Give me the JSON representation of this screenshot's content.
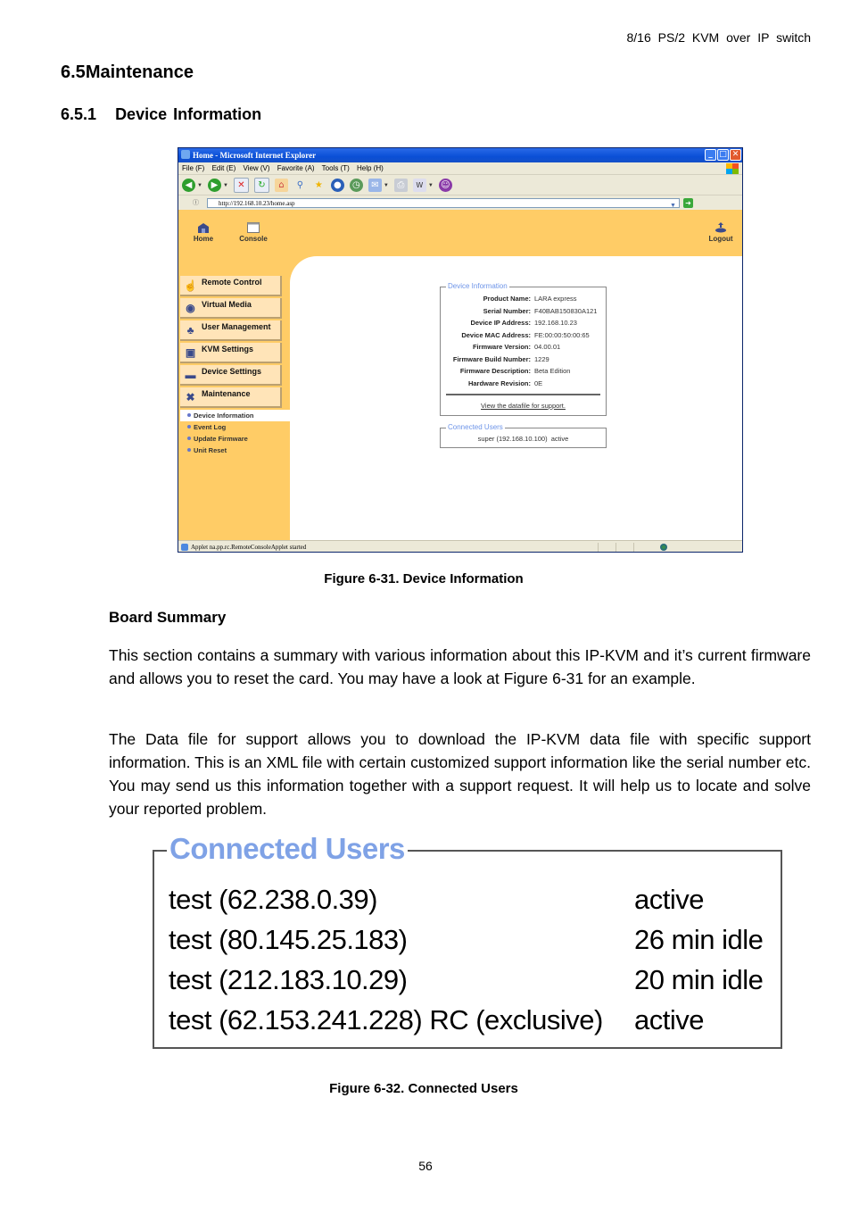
{
  "running_header": "8/16 PS/2 KVM over IP switch",
  "section": {
    "number": "6.5",
    "title": "Maintenance"
  },
  "subsection": {
    "number": "6.5.1",
    "title": "Device Information"
  },
  "browser": {
    "title": "Home - Microsoft Internet Explorer",
    "window_buttons": {
      "minimize": "_",
      "maximize": "□",
      "close": "✕"
    },
    "menu": [
      "File (F)",
      "Edit (E)",
      "View (V)",
      "Favorite (A)",
      "Tools (T)",
      "Help (H)"
    ],
    "address_label": "Ⓘ",
    "address": "http://192.168.10.23/home.asp",
    "top_nav": [
      {
        "label": "Home",
        "icon": "home-icon"
      },
      {
        "label": "Console",
        "icon": "console-window-icon"
      },
      {
        "label": "Logout",
        "icon": "logout-icon"
      }
    ],
    "sidebar": [
      {
        "label": "Remote Control",
        "icon": "remote-control-hand-icon"
      },
      {
        "label": "Virtual Media",
        "icon": "virtual-media-disc-icon"
      },
      {
        "label": "User Management",
        "icon": "users-icon"
      },
      {
        "label": "KVM Settings",
        "icon": "computer-icon"
      },
      {
        "label": "Device Settings",
        "icon": "device-icon"
      },
      {
        "label": "Maintenance",
        "icon": "tools-icon"
      }
    ],
    "submenu": [
      {
        "label": "Device Information",
        "active": true
      },
      {
        "label": "Event Log",
        "active": false
      },
      {
        "label": "Update Firmware",
        "active": false
      },
      {
        "label": "Unit Reset",
        "active": false
      }
    ],
    "device_info": {
      "legend": "Device Information",
      "rows": [
        {
          "label": "Product Name:",
          "value": "LARA express"
        },
        {
          "label": "Serial Number:",
          "value": "F40BAB150830A121"
        },
        {
          "label": "Device IP Address:",
          "value": "192.168.10.23"
        },
        {
          "label": "Device MAC Address:",
          "value": "FE:00:00:50:00:65"
        },
        {
          "label": "Firmware Version:",
          "value": "04.00.01"
        },
        {
          "label": "Firmware Build Number:",
          "value": "1229"
        },
        {
          "label": "Firmware Description:",
          "value": "Beta Edition"
        },
        {
          "label": "Hardware Revision:",
          "value": "0E"
        }
      ],
      "datafile_link": "View the datafile for support."
    },
    "connected_users_small": {
      "legend": "Connected Users",
      "entry": "super (192.168.10.100)  active"
    },
    "status_text": "Applet na.pp.rc.RemoteConsoleApplet started"
  },
  "figure1_caption": "Figure 6-31. Device Information",
  "board_summary": {
    "heading": "Board Summary",
    "paragraph1": "This section contains a summary with various information about this IP-KVM and it’s current firmware and allows you to reset the card. You may have a look at Figure 6-31 for an example.",
    "paragraph2": "The Data file for support allows you to download the IP-KVM data file with specific support information. This is an XML file with certain customized support information like the serial number etc. You may send us this information together with a support request. It will help us to locate and solve your reported problem."
  },
  "connected_users": {
    "legend": "Connected Users",
    "rows": [
      {
        "user": "test (62.238.0.39)",
        "status": "active"
      },
      {
        "user": "test (80.145.25.183)",
        "status": "26 min idle"
      },
      {
        "user": "test (212.183.10.29)",
        "status": "20 min idle"
      },
      {
        "user": "test (62.153.241.228) RC (exclusive)",
        "status": "active"
      }
    ]
  },
  "figure2_caption": "Figure 6-32. Connected Users",
  "page_number": "56",
  "colors": {
    "page_yellow": "#ffcc66",
    "legend_blue": "#7fa2e6",
    "title_blue": "#0a4fd6"
  }
}
